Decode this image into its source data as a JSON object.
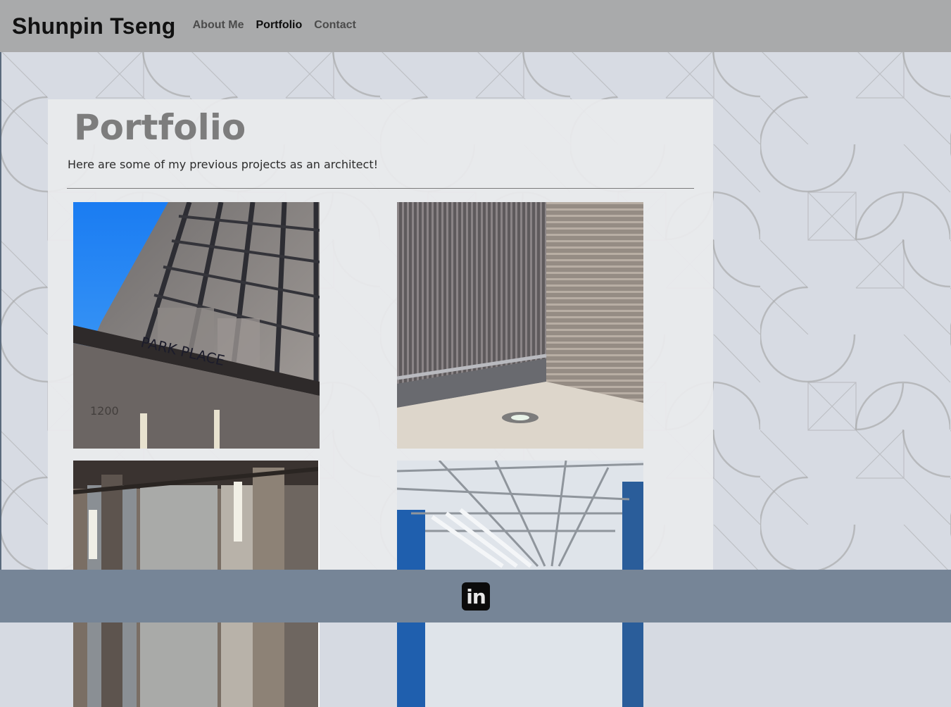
{
  "site": {
    "brand": "Shunpin Tseng",
    "nav": [
      {
        "label": "About Me",
        "active": false
      },
      {
        "label": "Portfolio",
        "active": true
      },
      {
        "label": "Contact",
        "active": false
      }
    ]
  },
  "main": {
    "title": "Portfolio",
    "intro": "Here are some of my previous projects as an architect!",
    "photo_sign_text": "PARK PLACE",
    "photo_address_text": "1200"
  },
  "footer": {
    "social_icon": "linkedin-icon",
    "social_icon_text": "in"
  },
  "colors": {
    "navbar": "#a9aaab",
    "footer": "#768597",
    "title": "#7d7d7d",
    "sky": "#2a86f0"
  }
}
